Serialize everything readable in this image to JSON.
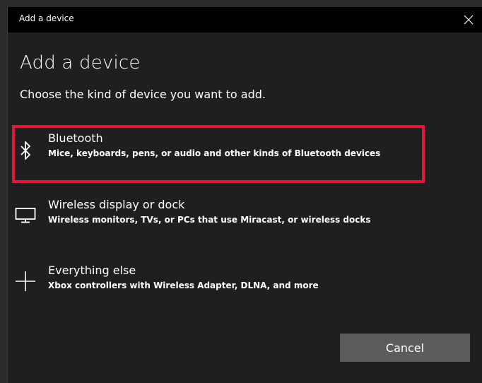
{
  "window": {
    "title": "Add a device"
  },
  "heading": "Add a device",
  "subheading": "Choose the kind of device you want to add.",
  "options": [
    {
      "label": "Bluetooth",
      "description": "Mice, keyboards, pens, or audio and other kinds of Bluetooth devices",
      "icon": "bluetooth-icon"
    },
    {
      "label": "Wireless display or dock",
      "description": "Wireless monitors, TVs, or PCs that use Miracast, or wireless docks",
      "icon": "monitor-icon"
    },
    {
      "label": "Everything else",
      "description": "Xbox controllers with Wireless Adapter, DLNA, and more",
      "icon": "plus-icon"
    }
  ],
  "cancel_label": "Cancel",
  "colors": {
    "background": "#1f1f1f",
    "titlebar": "#000000",
    "highlight": "#e0163c",
    "button": "#5c5c5c"
  }
}
